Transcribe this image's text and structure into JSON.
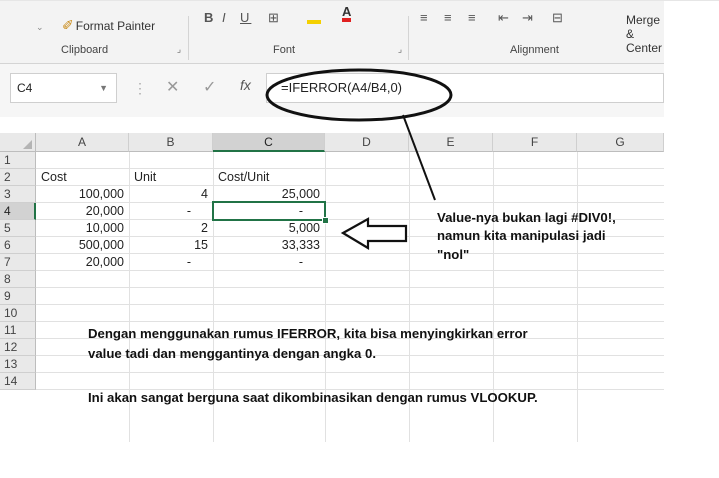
{
  "ribbon": {
    "format_painter_label": "Format Painter",
    "clipboard_label": "Clipboard",
    "font_label": "Font",
    "alignment_label": "Alignment",
    "merge_label": "Merge & Center"
  },
  "formula_bar": {
    "name_box": "C4",
    "formula": "=IFERROR(A4/B4,0)",
    "fx_label": "fx"
  },
  "columns": [
    "A",
    "B",
    "C",
    "D",
    "E",
    "F",
    "G"
  ],
  "rows": [
    "1",
    "2",
    "3",
    "4",
    "5",
    "6",
    "7",
    "8",
    "9",
    "10",
    "11",
    "12",
    "13",
    "14"
  ],
  "cells": {
    "A2": "Cost",
    "B2": "Unit",
    "C2": "Cost/Unit",
    "A3": "100,000",
    "B3": "4",
    "C3": "25,000",
    "A4": "20,000",
    "B4": "-",
    "C4": "-",
    "A5": "10,000",
    "B5": "2",
    "C5": "5,000",
    "A6": "500,000",
    "B6": "15",
    "C6": "33,333",
    "A7": "20,000",
    "B7": "-",
    "C7": "-"
  },
  "selected_cell": "C4",
  "annotations": {
    "callout_line1": "Value-nya bukan lagi #DIV0!,",
    "callout_line2": "namun kita manipulasi jadi",
    "callout_line3": "\"nol\"",
    "note1_line1": "Dengan menggunakan rumus IFERROR, kita bisa menyingkirkan error",
    "note1_line2": "value tadi dan menggantinya dengan angka 0.",
    "note2": "Ini akan sangat berguna saat dikombinasikan dengan rumus VLOOKUP."
  },
  "colors": {
    "selection": "#217346",
    "header_bg": "#e9e9e9"
  }
}
